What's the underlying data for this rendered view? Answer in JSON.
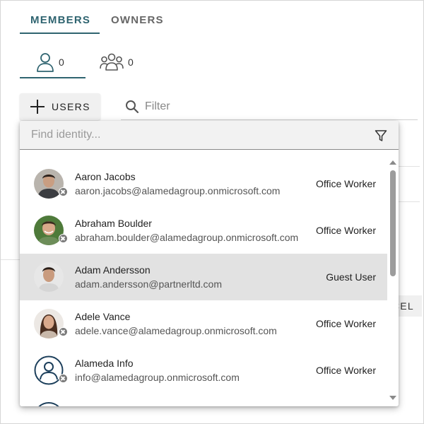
{
  "tabs": {
    "members": "MEMBERS",
    "owners": "OWNERS"
  },
  "subtabs": {
    "users_count": "0",
    "groups_count": "0"
  },
  "toolbar": {
    "add_users_label": "USERS",
    "filter_placeholder": "Filter"
  },
  "background": {
    "cancel_fragment": "CEL"
  },
  "dropdown": {
    "search_placeholder": "Find identity...",
    "items": [
      {
        "name": "Aaron Jacobs",
        "email": "aaron.jacobs@alamedagroup.onmicrosoft.com",
        "role": "Office Worker"
      },
      {
        "name": "Abraham Boulder",
        "email": "abraham.boulder@alamedagroup.onmicrosoft.com",
        "role": "Office Worker"
      },
      {
        "name": "Adam Andersson",
        "email": "adam.andersson@partnerltd.com",
        "role": "Guest User"
      },
      {
        "name": "Adele Vance",
        "email": "adele.vance@alamedagroup.onmicrosoft.com",
        "role": "Office Worker"
      },
      {
        "name": "Alameda Info",
        "email": "info@alamedagroup.onmicrosoft.com",
        "role": "Office Worker"
      }
    ]
  },
  "colors": {
    "accent": "#2f6470",
    "selected_row": "#e2e2e2",
    "presence_badge": "#7a7a7a"
  }
}
